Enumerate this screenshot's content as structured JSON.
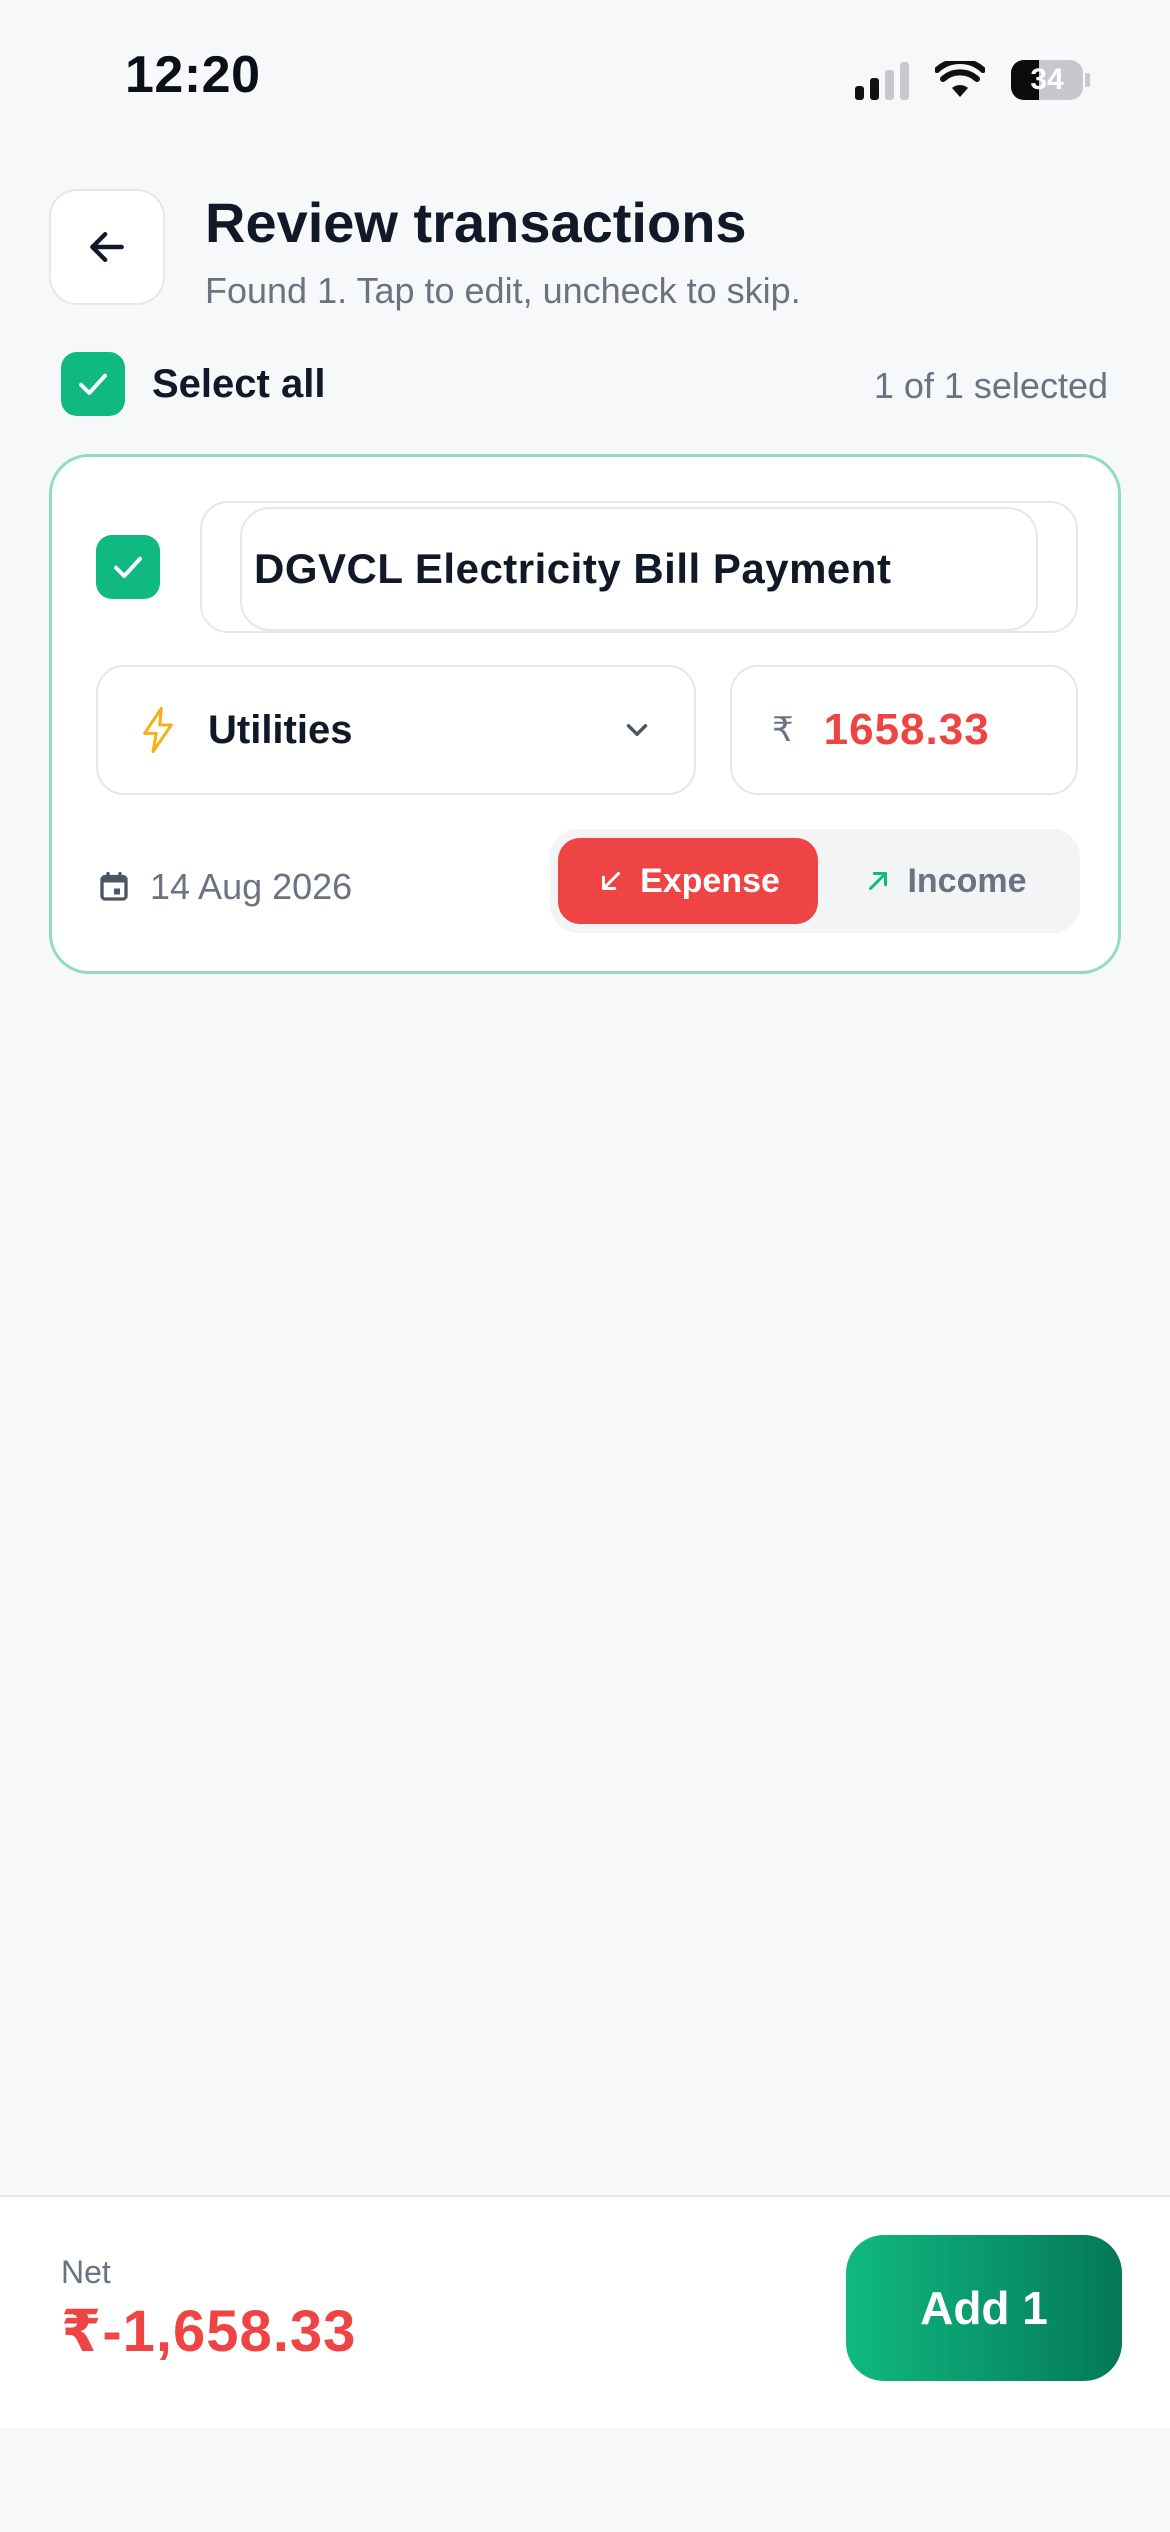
{
  "status_bar": {
    "time": "12:20",
    "battery": "34"
  },
  "header": {
    "title": "Review transactions",
    "subtitle": "Found 1. Tap to edit, uncheck to skip."
  },
  "selection": {
    "select_all_label": "Select all",
    "count_text": "1 of 1 selected"
  },
  "transactions": [
    {
      "title": "DGVCL Electricity Bill Payment",
      "category": "Utilities",
      "category_icon": "lightning-icon",
      "currency_symbol": "₹",
      "amount": "1658.33",
      "date": "14 Aug 2026",
      "type_options": [
        "Expense",
        "Income"
      ],
      "selected_type": "Expense",
      "checked": true
    }
  ],
  "footer": {
    "net_label": "Net",
    "net_value": "₹-1,658.33",
    "add_button": "Add 1"
  },
  "colors": {
    "accent": "#10b981",
    "expense": "#ef4444",
    "income_arrow": "#10b981"
  }
}
